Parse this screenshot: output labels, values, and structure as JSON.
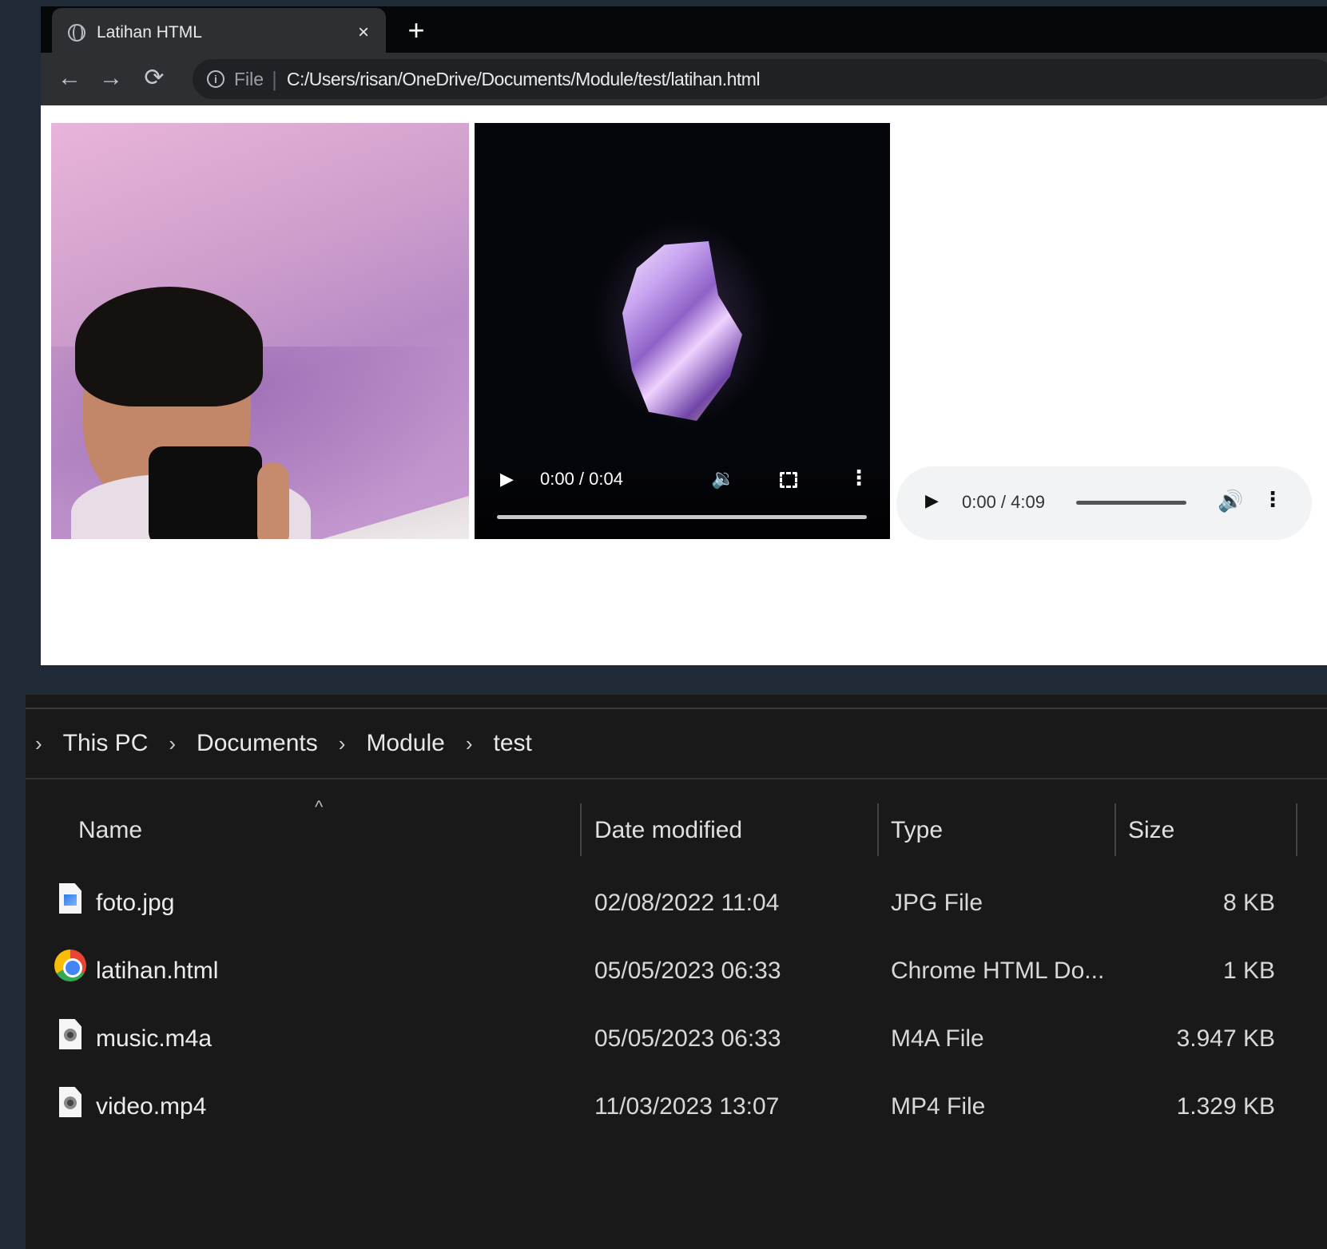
{
  "browser": {
    "tab_title": "Latihan HTML",
    "tab_close": "×",
    "new_tab": "+",
    "nav": {
      "back": "←",
      "forward": "→",
      "reload": "⟳"
    },
    "omnibox": {
      "info": "i",
      "scheme": "File",
      "separator": "|",
      "url": "C:/Users/risan/OneDrive/Documents/Module/test/latihan.html"
    }
  },
  "video_player": {
    "play": "▶",
    "time": "0:00 / 0:04",
    "mute": "🔉",
    "more": "⋮"
  },
  "audio_player": {
    "play": "▶",
    "time": "0:00 / 4:09",
    "volume": "🔊",
    "more": "⋮"
  },
  "explorer": {
    "breadcrumb": [
      "This PC",
      "Documents",
      "Module",
      "test"
    ],
    "chevron": "›",
    "columns": {
      "name": "Name",
      "date": "Date modified",
      "type": "Type",
      "size": "Size",
      "sort_indicator": "^"
    },
    "files": [
      {
        "name": "foto.jpg",
        "date": "02/08/2022 11:04",
        "type": "JPG File",
        "size": "8 KB",
        "icon": "image-file-icon"
      },
      {
        "name": "latihan.html",
        "date": "05/05/2023 06:33",
        "type": "Chrome HTML Do...",
        "size": "1 KB",
        "icon": "chrome-icon"
      },
      {
        "name": "music.m4a",
        "date": "05/05/2023 06:33",
        "type": "M4A File",
        "size": "3.947 KB",
        "icon": "media-file-icon"
      },
      {
        "name": "video.mp4",
        "date": "11/03/2023 13:07",
        "type": "MP4 File",
        "size": "1.329 KB",
        "icon": "media-file-icon"
      }
    ]
  }
}
